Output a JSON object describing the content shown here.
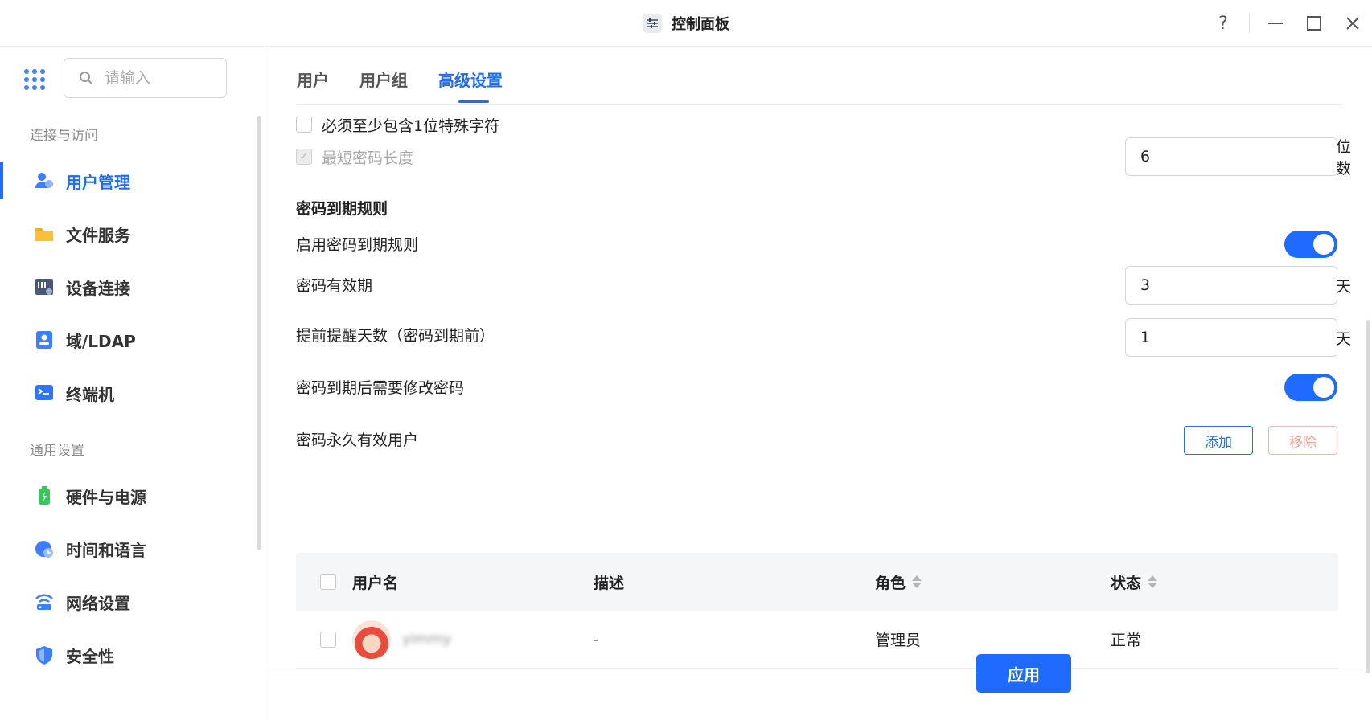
{
  "window": {
    "title": "控制面板",
    "controls": {
      "help": "?",
      "minimize": "—",
      "maximize": "☐",
      "close": "✕"
    }
  },
  "sidebar": {
    "search": {
      "placeholder": "请输入",
      "value": ""
    },
    "sections": [
      {
        "label": "连接与访问"
      },
      {
        "label": "通用设置"
      }
    ],
    "items": [
      {
        "label": "用户管理",
        "icon": "users-icon",
        "active": true
      },
      {
        "label": "文件服务",
        "icon": "folder-icon"
      },
      {
        "label": "设备连接",
        "icon": "device-icon"
      },
      {
        "label": "域/LDAP",
        "icon": "ldap-icon"
      },
      {
        "label": "终端机",
        "icon": "terminal-icon"
      },
      {
        "label": "硬件与电源",
        "icon": "battery-icon"
      },
      {
        "label": "时间和语言",
        "icon": "clock-icon"
      },
      {
        "label": "网络设置",
        "icon": "network-icon"
      },
      {
        "label": "安全性",
        "icon": "shield-icon"
      }
    ]
  },
  "tabs": [
    {
      "label": "用户"
    },
    {
      "label": "用户组"
    },
    {
      "label": "高级设置",
      "active": true
    }
  ],
  "settings": {
    "special_char": {
      "label": "必须至少包含1位特殊字符",
      "checked": false
    },
    "min_length": {
      "label": "最短密码长度",
      "checked": true,
      "disabled": true,
      "value": "6",
      "unit": "位数"
    },
    "expiry_section_title": "密码到期规则",
    "enable_expiry": {
      "label": "启用密码到期规则",
      "on": true
    },
    "validity": {
      "label": "密码有效期",
      "value": "3",
      "unit": "天"
    },
    "remind_days": {
      "label": "提前提醒天数（密码到期前）",
      "value": "1",
      "unit": "天"
    },
    "force_change": {
      "label": "密码到期后需要修改密码",
      "on": true
    },
    "permanent_users": {
      "label": "密码永久有效用户",
      "add_label": "添加",
      "remove_label": "移除"
    }
  },
  "table": {
    "columns": {
      "username": "用户名",
      "description": "描述",
      "role": "角色",
      "status": "状态"
    },
    "rows": [
      {
        "username": "yimmy",
        "description": "-",
        "role": "管理员",
        "status": "正常"
      }
    ]
  },
  "footer": {
    "apply_label": "应用"
  },
  "colors": {
    "accent": "#1f6bff",
    "danger_disabled": "#f0a297"
  }
}
